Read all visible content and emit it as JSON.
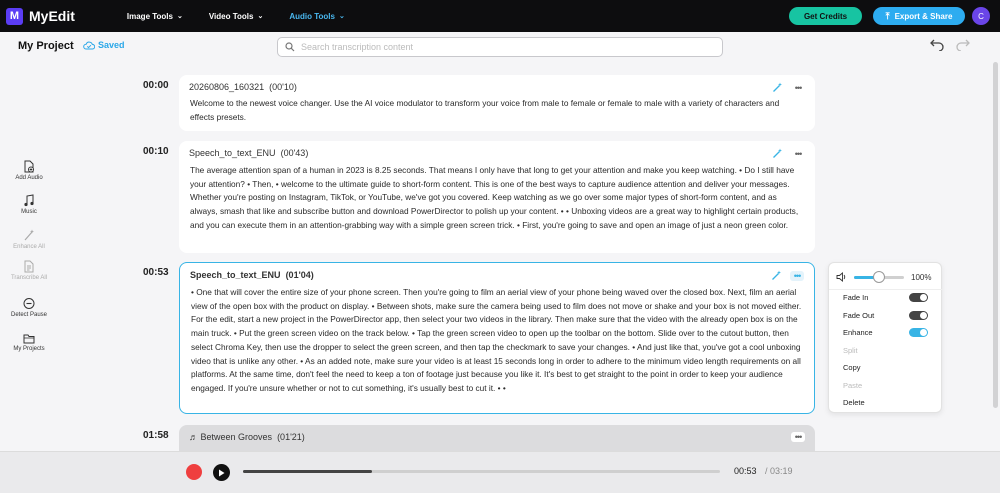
{
  "app": {
    "name": "MyEdit",
    "logo_letter": "M"
  },
  "nav": [
    {
      "label": "Image Tools",
      "active": false
    },
    {
      "label": "Video Tools",
      "active": false
    },
    {
      "label": "Audio Tools",
      "active": true
    }
  ],
  "header": {
    "credits_label": "Get Credits",
    "export_label": "Export & Share",
    "avatar_letter": "C"
  },
  "project": {
    "title": "My Project",
    "saved_label": "Saved"
  },
  "search": {
    "placeholder": "Search transcription content",
    "value": ""
  },
  "sidebar": [
    {
      "label": "Add Audio",
      "icon": "add-audio-icon",
      "enabled": true
    },
    {
      "label": "Music",
      "icon": "music-icon",
      "enabled": true
    },
    {
      "label": "Enhance All",
      "icon": "magic-wand-icon",
      "enabled": false
    },
    {
      "label": "Transcribe All",
      "icon": "transcribe-icon",
      "enabled": false
    },
    {
      "label": "Detect Pause",
      "icon": "pause-icon",
      "enabled": true
    },
    {
      "label": "My Projects",
      "icon": "folder-icon",
      "enabled": true
    }
  ],
  "clips": [
    {
      "timecode": "00:00",
      "name": "20260806_160321",
      "duration": "(00'10)",
      "text": "Welcome to the newest voice changer. Use the AI voice modulator to transform your voice from male to female or female to male with a variety of characters and effects presets."
    },
    {
      "timecode": "00:10",
      "name": "Speech_to_text_ENU",
      "duration": "(00'43)",
      "text": "The average attention span of a human in 2023 is 8.25 seconds. That means I only have that long to get your attention and make you keep watching. • Do I still have your attention? • Then, • welcome to the ultimate guide to short-form content. This is one of the best ways to capture audience attention and deliver your messages. Whether you're posting on Instagram, TikTok, or YouTube, we've got you covered. Keep watching as we go over some major types of short-form content, and as always, smash that like and subscribe button and download PowerDirector to polish up your content. • • Unboxing videos are a great way to highlight certain products, and you can execute them in an attention-grabbing way with a simple green screen trick. • First, you're going to save and open an image of just a neon green color."
    },
    {
      "timecode": "00:53",
      "name": "Speech_to_text_ENU",
      "duration": "(01'04)",
      "text": "• One that will cover the entire size of your phone screen. Then you're going to film an aerial view of your phone being waved over the closed box. Next, film an aerial view of the open box with the product on display. • Between shots, make sure the camera being used to film does not move or shake and your box is not moved either. For the edit, start a new project in the PowerDirector app, then select your two videos in the library. Then make sure that the video with the already open box is on the main truck. • Put the green screen video on the track below. • Tap the green screen video to open up the toolbar on the bottom. Slide over to the cutout button, then select Chroma Key, then use the dropper to select the green screen, and then tap the checkmark to save your changes. • And just like that, you've got a cool unboxing video that is unlike any other. • As an added note, make sure your video is at least 15 seconds long in order to adhere to the minimum video length requirements on all platforms. At the same time, don't feel the need to keep a ton of footage just because you like it. It's best to get straight to the point in order to keep your audience engaged. If you're unsure whether or not to cut something, it's usually best to cut it. • •"
    },
    {
      "timecode": "01:58",
      "name": "♬ Between Grooves",
      "duration": "(01'21)",
      "text": ""
    }
  ],
  "context_menu": {
    "volume_percent": 100,
    "volume_label": "100%",
    "volume_slider_fraction": 0.5,
    "items": [
      {
        "label": "Fade In",
        "toggle": false,
        "enabled": true
      },
      {
        "label": "Fade Out",
        "toggle": false,
        "enabled": true
      },
      {
        "label": "Enhance",
        "toggle": true,
        "enabled": true
      },
      {
        "label": "Split",
        "enabled": false
      },
      {
        "label": "Copy",
        "enabled": true
      },
      {
        "label": "Paste",
        "enabled": false
      },
      {
        "label": "Delete",
        "enabled": true
      }
    ]
  },
  "player": {
    "current_time": "00:53",
    "total_time": "/ 03:19",
    "progress_fraction": 0.27
  },
  "colors": {
    "accent": "#38b4e5",
    "brand": "#5b3df5",
    "credits": "#17c4a2",
    "export": "#2dacf0",
    "record": "#ef3f3f"
  }
}
